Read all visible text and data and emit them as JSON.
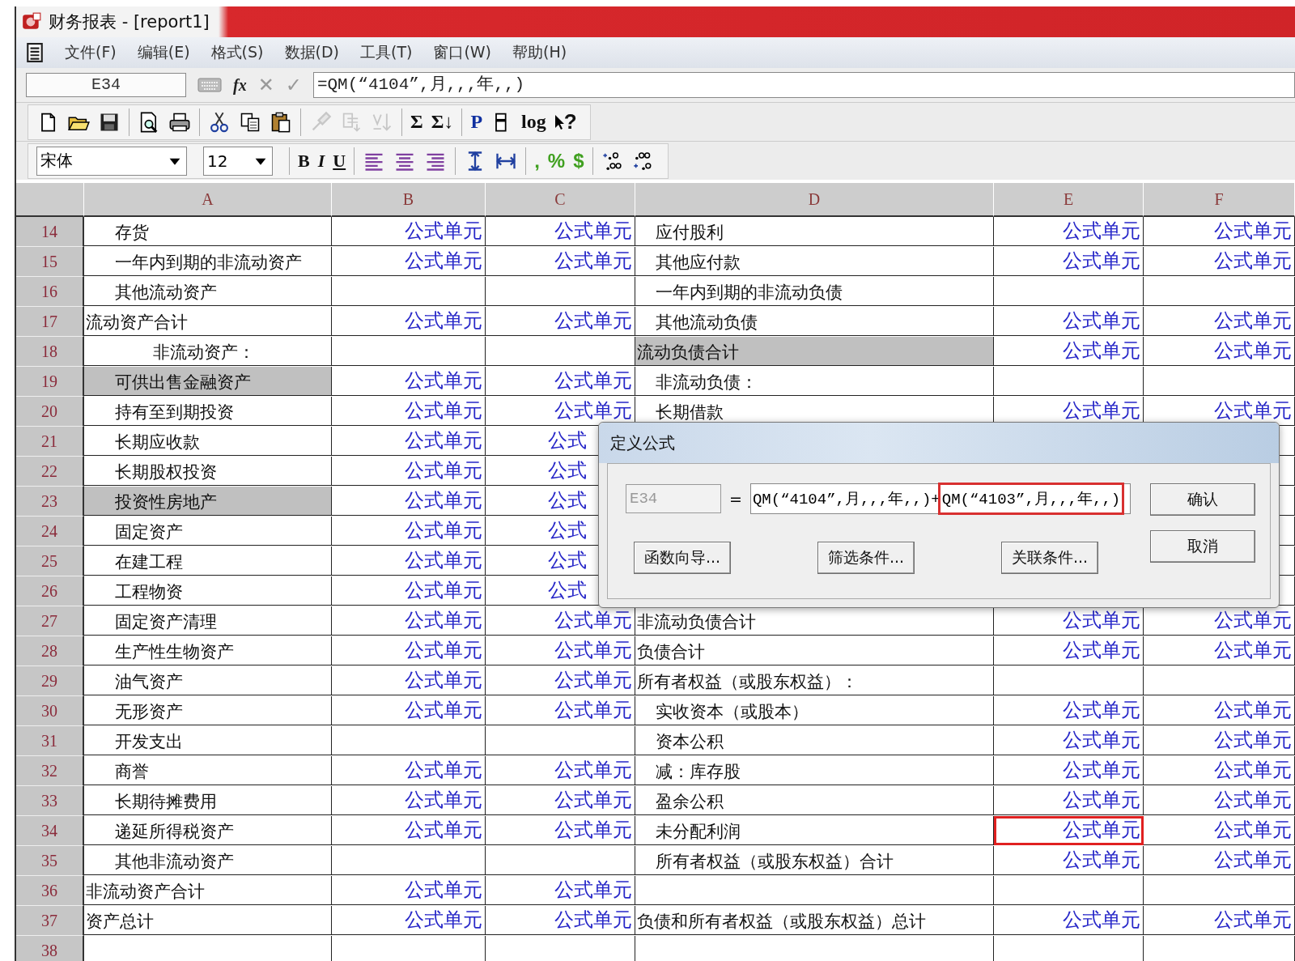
{
  "window": {
    "title": "财务报表 - [report1]"
  },
  "menu": [
    "文件(F)",
    "编辑(E)",
    "格式(S)",
    "数据(D)",
    "工具(T)",
    "窗口(W)",
    "帮助(H)"
  ],
  "formula_bar": {
    "cell": "E34",
    "fx": "fx",
    "cancel": "✕",
    "accept": "✓",
    "formula": "=QM(“4104”,月,,,年,,)"
  },
  "toolbar": {
    "groups": [
      [
        {
          "kind": "new",
          "disabled": false
        },
        {
          "kind": "open",
          "disabled": false
        },
        {
          "kind": "save",
          "disabled": false
        }
      ],
      [
        {
          "kind": "preview",
          "disabled": false
        },
        {
          "kind": "print",
          "disabled": false
        }
      ],
      [
        {
          "kind": "cut",
          "disabled": false
        },
        {
          "kind": "copy",
          "disabled": false
        },
        {
          "kind": "paste",
          "disabled": false
        }
      ],
      [
        {
          "kind": "brush",
          "disabled": true
        },
        {
          "kind": "rows",
          "disabled": true
        },
        {
          "kind": "sort",
          "disabled": true
        }
      ],
      [
        {
          "kind": "text",
          "label": "Σ",
          "disabled": false
        },
        {
          "kind": "text",
          "label": "Σ↓",
          "disabled": false
        }
      ],
      [
        {
          "kind": "text",
          "label": "P",
          "disabled": false
        },
        {
          "kind": "page",
          "disabled": false
        },
        {
          "kind": "text",
          "label": "log",
          "disabled": false
        },
        {
          "kind": "help",
          "label": "?",
          "disabled": false
        }
      ]
    ]
  },
  "format_bar": {
    "font": "宋体",
    "size": "12",
    "groups": [
      [
        {
          "kind": "bold",
          "label": "B"
        },
        {
          "kind": "italic",
          "label": "I"
        },
        {
          "kind": "underline",
          "label": "U"
        }
      ],
      [
        {
          "kind": "align-left"
        },
        {
          "kind": "align-center"
        },
        {
          "kind": "align-right"
        }
      ],
      [
        {
          "kind": "row-height"
        },
        {
          "kind": "col-width"
        }
      ],
      [
        {
          "kind": "symbol",
          "label": ","
        },
        {
          "kind": "symbol",
          "label": "%"
        },
        {
          "kind": "symbol",
          "label": "$"
        }
      ],
      [
        {
          "kind": "decimal-more"
        },
        {
          "kind": "decimal-less"
        }
      ]
    ]
  },
  "table": {
    "columns": [
      "A",
      "B",
      "C",
      "D",
      "E",
      "F"
    ],
    "rows": [
      {
        "num": "14",
        "cells": [
          {
            "text": "存货",
            "kind": "item",
            "selected": false
          },
          {
            "text": "公式单元",
            "kind": "formula",
            "selected": false
          },
          {
            "text": "公式单元",
            "kind": "formula",
            "selected": false
          },
          {
            "text": "应付股利",
            "kind": "item",
            "selected": false
          },
          {
            "text": "公式单元",
            "kind": "formula",
            "selected": false
          },
          {
            "text": "公式单元",
            "kind": "formula",
            "selected": false
          }
        ]
      },
      {
        "num": "15",
        "cells": [
          {
            "text": "一年内到期的非流动资产",
            "kind": "item",
            "selected": false
          },
          {
            "text": "公式单元",
            "kind": "formula",
            "selected": false
          },
          {
            "text": "公式单元",
            "kind": "formula",
            "selected": false
          },
          {
            "text": "其他应付款",
            "kind": "item",
            "selected": false
          },
          {
            "text": "公式单元",
            "kind": "formula",
            "selected": false
          },
          {
            "text": "公式单元",
            "kind": "formula",
            "selected": false
          }
        ]
      },
      {
        "num": "16",
        "cells": [
          {
            "text": "其他流动资产",
            "kind": "item",
            "selected": false
          },
          {
            "selected": false
          },
          {
            "selected": false
          },
          {
            "text": "一年内到期的非流动负债",
            "kind": "item",
            "selected": false
          },
          {
            "selected": false
          },
          {
            "selected": false
          }
        ]
      },
      {
        "num": "17",
        "cells": [
          {
            "text": "流动资产合计",
            "kind": "total",
            "selected": false
          },
          {
            "text": "公式单元",
            "kind": "formula",
            "selected": false
          },
          {
            "text": "公式单元",
            "kind": "formula",
            "selected": false
          },
          {
            "text": "其他流动负债",
            "kind": "item",
            "selected": false
          },
          {
            "text": "公式单元",
            "kind": "formula",
            "selected": false
          },
          {
            "text": "公式单元",
            "kind": "formula",
            "selected": false
          }
        ]
      },
      {
        "num": "18",
        "cells": [
          {
            "text": "非流动资产：",
            "kind": "section",
            "selected": false
          },
          {
            "selected": false
          },
          {
            "selected": false
          },
          {
            "text": "流动负债合计",
            "kind": "total",
            "selected": true
          },
          {
            "text": "公式单元",
            "kind": "formula",
            "selected": false
          },
          {
            "text": "公式单元",
            "kind": "formula",
            "selected": false
          }
        ]
      },
      {
        "num": "19",
        "cells": [
          {
            "text": "可供出售金融资产",
            "kind": "item",
            "selected": true
          },
          {
            "text": "公式单元",
            "kind": "formula",
            "selected": false
          },
          {
            "text": "公式单元",
            "kind": "formula",
            "selected": false
          },
          {
            "text": "非流动负债：",
            "kind": "item",
            "selected": false
          },
          {
            "selected": false
          },
          {
            "selected": false
          }
        ]
      },
      {
        "num": "20",
        "cells": [
          {
            "text": "持有至到期投资",
            "kind": "item",
            "selected": false
          },
          {
            "text": "公式单元",
            "kind": "formula",
            "selected": false
          },
          {
            "text": "公式单元",
            "kind": "formula",
            "selected": false
          },
          {
            "text": "长期借款",
            "kind": "item",
            "selected": false
          },
          {
            "text": "公式单元",
            "kind": "formula",
            "selected": false
          },
          {
            "text": "公式单元",
            "kind": "formula",
            "selected": false
          }
        ]
      },
      {
        "num": "21",
        "cells": [
          {
            "text": "长期应收款",
            "kind": "item",
            "selected": false
          },
          {
            "text": "公式单元",
            "kind": "formula",
            "selected": false
          },
          {
            "text": "公式",
            "kind": "clipped",
            "selected": false
          },
          {},
          {},
          {
            "selected": false
          }
        ]
      },
      {
        "num": "22",
        "cells": [
          {
            "text": "长期股权投资",
            "kind": "item",
            "selected": false
          },
          {
            "text": "公式单元",
            "kind": "formula",
            "selected": false
          },
          {
            "text": "公式",
            "kind": "clipped",
            "selected": false
          },
          {},
          {},
          {
            "selected": false
          }
        ]
      },
      {
        "num": "23",
        "cells": [
          {
            "text": "投资性房地产",
            "kind": "item",
            "selected": true
          },
          {
            "text": "公式单元",
            "kind": "formula",
            "selected": false
          },
          {
            "text": "公式",
            "kind": "clipped",
            "selected": false
          },
          {},
          {},
          {
            "selected": false
          }
        ]
      },
      {
        "num": "24",
        "cells": [
          {
            "text": "固定资产",
            "kind": "item",
            "selected": false
          },
          {
            "text": "公式单元",
            "kind": "formula",
            "selected": false
          },
          {
            "text": "公式",
            "kind": "clipped",
            "selected": false
          },
          {},
          {},
          {
            "selected": false
          }
        ]
      },
      {
        "num": "25",
        "cells": [
          {
            "text": "在建工程",
            "kind": "item",
            "selected": false
          },
          {
            "text": "公式单元",
            "kind": "formula",
            "selected": false
          },
          {
            "text": "公式",
            "kind": "clipped",
            "selected": false
          },
          {},
          {},
          {
            "selected": false
          }
        ]
      },
      {
        "num": "26",
        "cells": [
          {
            "text": "工程物资",
            "kind": "item",
            "selected": false
          },
          {
            "text": "公式单元",
            "kind": "formula",
            "selected": false
          },
          {
            "text": "公式",
            "kind": "clipped",
            "selected": false
          },
          {},
          {},
          {
            "selected": false
          }
        ]
      },
      {
        "num": "27",
        "cells": [
          {
            "text": "固定资产清理",
            "kind": "item",
            "selected": false
          },
          {
            "text": "公式单元",
            "kind": "formula",
            "selected": false
          },
          {
            "text": "公式单元",
            "kind": "formula",
            "selected": false
          },
          {
            "text": "非流动负债合计",
            "kind": "total",
            "selected": false
          },
          {
            "text": "公式单元",
            "kind": "formula",
            "selected": false
          },
          {
            "text": "公式单元",
            "kind": "formula",
            "selected": false
          }
        ]
      },
      {
        "num": "28",
        "cells": [
          {
            "text": "生产性生物资产",
            "kind": "item",
            "selected": false
          },
          {
            "text": "公式单元",
            "kind": "formula",
            "selected": false
          },
          {
            "text": "公式单元",
            "kind": "formula",
            "selected": false
          },
          {
            "text": "负债合计",
            "kind": "total",
            "selected": false
          },
          {
            "text": "公式单元",
            "kind": "formula",
            "selected": false
          },
          {
            "text": "公式单元",
            "kind": "formula",
            "selected": false
          }
        ]
      },
      {
        "num": "29",
        "cells": [
          {
            "text": "油气资产",
            "kind": "item",
            "selected": false
          },
          {
            "text": "公式单元",
            "kind": "formula",
            "selected": false
          },
          {
            "text": "公式单元",
            "kind": "formula",
            "selected": false
          },
          {
            "text": "所有者权益（或股东权益）：",
            "kind": "total",
            "selected": false
          },
          {
            "selected": false
          },
          {
            "selected": false
          }
        ]
      },
      {
        "num": "30",
        "cells": [
          {
            "text": "无形资产",
            "kind": "item",
            "selected": false
          },
          {
            "text": "公式单元",
            "kind": "formula",
            "selected": false
          },
          {
            "text": "公式单元",
            "kind": "formula",
            "selected": false
          },
          {
            "text": "实收资本（或股本）",
            "kind": "item",
            "selected": false
          },
          {
            "text": "公式单元",
            "kind": "formula",
            "selected": false
          },
          {
            "text": "公式单元",
            "kind": "formula",
            "selected": false
          }
        ]
      },
      {
        "num": "31",
        "cells": [
          {
            "text": "开发支出",
            "kind": "item",
            "selected": false
          },
          {
            "selected": false
          },
          {
            "selected": false
          },
          {
            "text": "资本公积",
            "kind": "item",
            "selected": false
          },
          {
            "text": "公式单元",
            "kind": "formula",
            "selected": false
          },
          {
            "text": "公式单元",
            "kind": "formula",
            "selected": false
          }
        ]
      },
      {
        "num": "32",
        "cells": [
          {
            "text": "商誉",
            "kind": "item",
            "selected": false
          },
          {
            "text": "公式单元",
            "kind": "formula",
            "selected": false
          },
          {
            "text": "公式单元",
            "kind": "formula",
            "selected": false
          },
          {
            "text": "减：库存股",
            "kind": "item",
            "selected": false
          },
          {
            "text": "公式单元",
            "kind": "formula",
            "selected": false
          },
          {
            "text": "公式单元",
            "kind": "formula",
            "selected": false
          }
        ]
      },
      {
        "num": "33",
        "cells": [
          {
            "text": "长期待摊费用",
            "kind": "item",
            "selected": false
          },
          {
            "text": "公式单元",
            "kind": "formula",
            "selected": false
          },
          {
            "text": "公式单元",
            "kind": "formula",
            "selected": false
          },
          {
            "text": "盈余公积",
            "kind": "item",
            "selected": false
          },
          {
            "text": "公式单元",
            "kind": "formula",
            "selected": false
          },
          {
            "text": "公式单元",
            "kind": "formula",
            "selected": false
          }
        ]
      },
      {
        "num": "34",
        "cells": [
          {
            "text": "递延所得税资产",
            "kind": "item",
            "selected": false
          },
          {
            "text": "公式单元",
            "kind": "formula",
            "selected": false
          },
          {
            "text": "公式单元",
            "kind": "formula",
            "selected": false
          },
          {
            "text": "未分配利润",
            "kind": "item",
            "selected": false
          },
          {
            "text": "公式单元",
            "kind": "formula",
            "selected": false,
            "boxed": true
          },
          {
            "text": "公式单元",
            "kind": "formula",
            "selected": false
          }
        ]
      },
      {
        "num": "35",
        "cells": [
          {
            "text": "其他非流动资产",
            "kind": "item",
            "selected": false
          },
          {
            "selected": false
          },
          {
            "selected": false
          },
          {
            "text": "所有者权益（或股东权益）合计",
            "kind": "item",
            "selected": false
          },
          {
            "text": "公式单元",
            "kind": "formula",
            "selected": false
          },
          {
            "text": "公式单元",
            "kind": "formula",
            "selected": false
          }
        ]
      },
      {
        "num": "36",
        "cells": [
          {
            "text": "非流动资产合计",
            "kind": "total",
            "selected": false
          },
          {
            "text": "公式单元",
            "kind": "formula",
            "selected": false
          },
          {
            "text": "公式单元",
            "kind": "formula",
            "selected": false
          },
          {
            "selected": false
          },
          {
            "selected": false
          },
          {
            "selected": false
          }
        ]
      },
      {
        "num": "37",
        "cells": [
          {
            "text": "资产总计",
            "kind": "total",
            "selected": false
          },
          {
            "text": "公式单元",
            "kind": "formula",
            "selected": false
          },
          {
            "text": "公式单元",
            "kind": "formula",
            "selected": false
          },
          {
            "text": "负债和所有者权益（或股东权益）总计",
            "kind": "total",
            "selected": false
          },
          {
            "text": "公式单元",
            "kind": "formula",
            "selected": false
          },
          {
            "text": "公式单元",
            "kind": "formula",
            "selected": false
          }
        ]
      },
      {
        "num": "38",
        "cells": [
          {
            "selected": false
          },
          {
            "selected": false
          },
          {
            "selected": false
          },
          {
            "selected": false
          },
          {
            "selected": false
          },
          {
            "selected": false
          }
        ]
      }
    ]
  },
  "dialog": {
    "title": "定义公式",
    "cell": "E34",
    "equals": "=",
    "formula_parts": [
      {
        "text": "QM(“4104”,月,,,年,,)+",
        "boxed": false
      },
      {
        "text": "QM(“4103”,月,,,年,,)",
        "boxed": true
      }
    ],
    "buttons": [
      {
        "label": "确认",
        "kind": "side"
      },
      {
        "label": "取消",
        "kind": "side"
      },
      {
        "label": "函数向导...",
        "kind": "bottom"
      },
      {
        "label": "筛选条件...",
        "kind": "bottom"
      },
      {
        "label": "关联条件...",
        "kind": "bottom"
      }
    ]
  }
}
